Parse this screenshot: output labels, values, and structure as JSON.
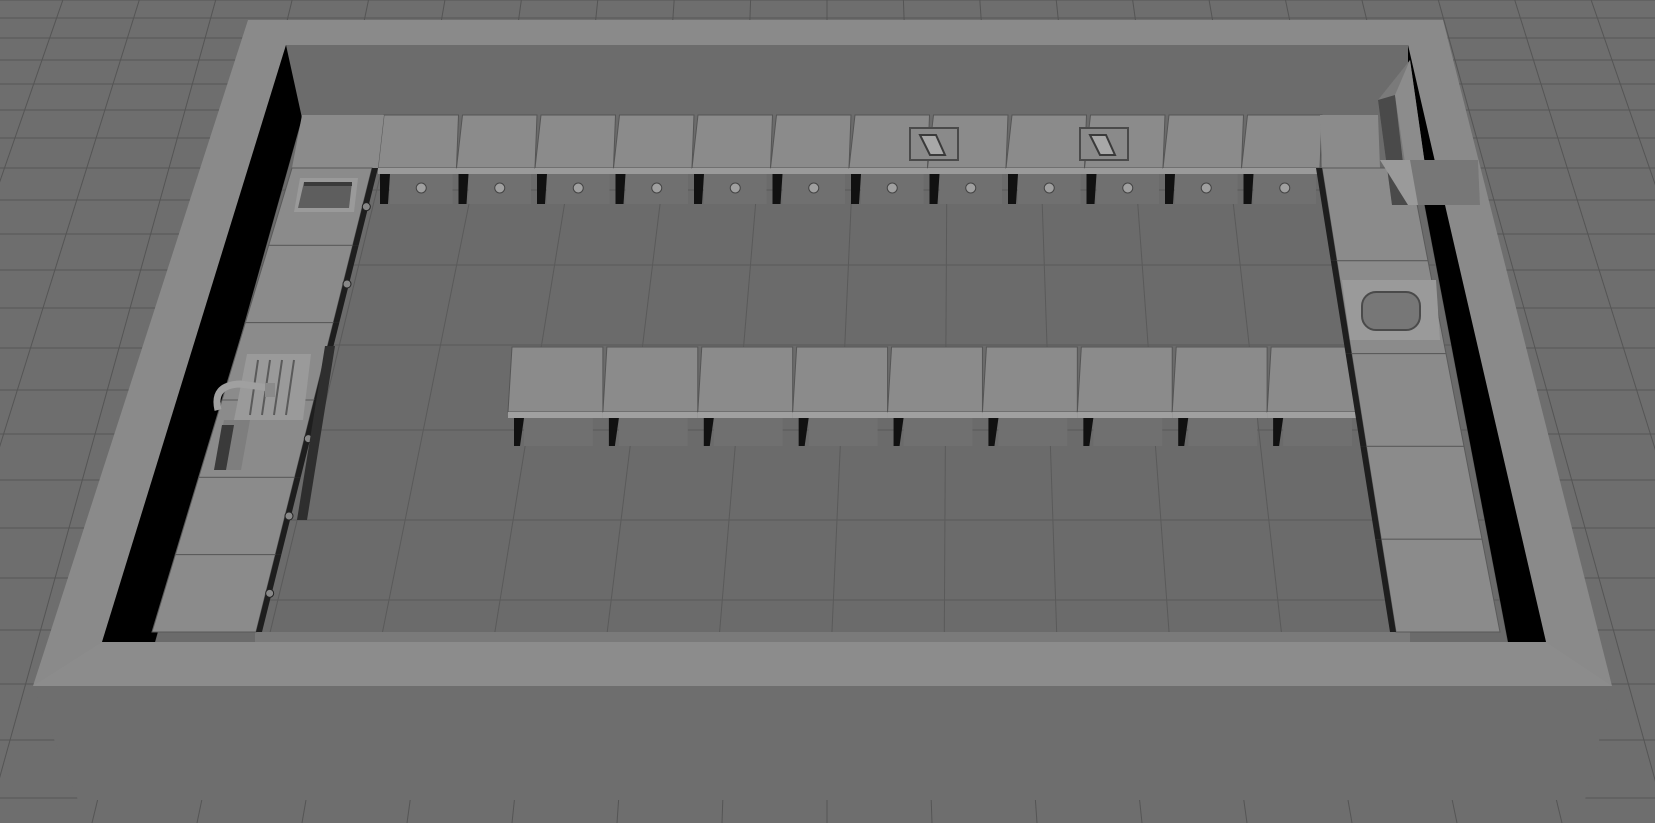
{
  "viewport": {
    "background_color": "#6e6e6e",
    "grid_line_color": "#555555",
    "floor_color": "#6b6b6b",
    "wall_top_color": "#8a8a8a",
    "wall_front_color": "#6e6e6e",
    "wall_inner_color": "#707070",
    "wall_shadow_color": "#000000",
    "counter_top_color": "#8b8b8b",
    "counter_front_color": "#747474",
    "cabinet_color": "#707070",
    "fixture_dark_color": "#3a3a3a"
  },
  "scene": {
    "room_shape": "rectangular-walled-room",
    "back_counter_modules": 12,
    "island_counter_modules": 9,
    "left_counter_modules": 6,
    "right_counter_modules": 5,
    "fixtures": [
      "sink",
      "faucet",
      "dish-rack",
      "stove-burner",
      "stove-burner",
      "range-hood",
      "wash-basin",
      "oven-door"
    ]
  }
}
